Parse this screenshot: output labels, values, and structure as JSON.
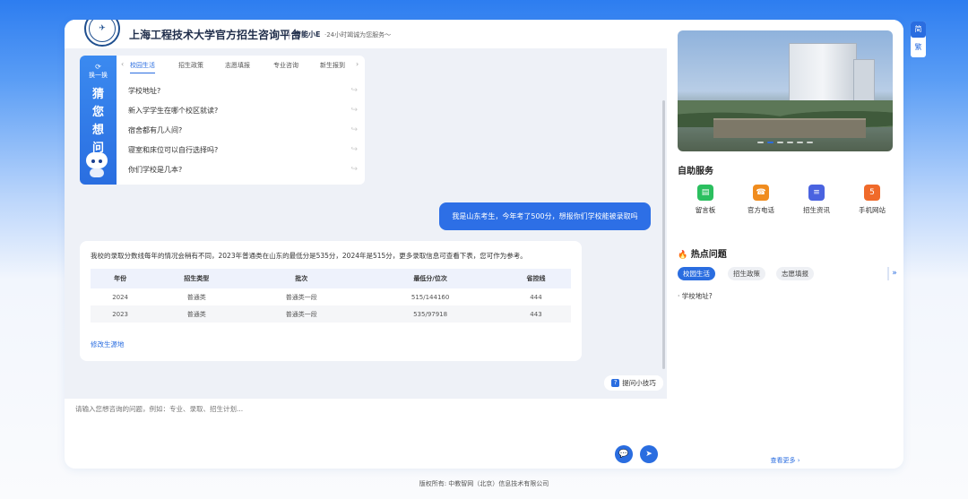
{
  "header": {
    "site_title": "上海工程技术大学官方招生咨询平台",
    "brand": "智能小E",
    "slogan": "·24小时竭诚为您服务～"
  },
  "qa_panel": {
    "refresh_label": "换一换",
    "side_chars": [
      "猜",
      "您",
      "想",
      "问"
    ],
    "tabs": [
      "校园生活",
      "招生政策",
      "志愿填报",
      "专业咨询",
      "新生报到"
    ],
    "active_tab": "校园生活",
    "questions": [
      "学校地址?",
      "新入学学生在哪个校区就读?",
      "宿舍都有几人间?",
      "寝室和床位可以自行选择吗?",
      "你们学校是几本?"
    ]
  },
  "chat": {
    "user_message": "我是山东考生，今年考了500分，想报你们学校能被录取吗",
    "bot_message": "我校的录取分数线每年的情况会稍有不同，2023年普通类在山东的最低分是535分，2024年是515分，更多录取信息可查看下表，您可作为参考。",
    "table_headers": [
      "年份",
      "招生类型",
      "批次",
      "最低分/位次",
      "省控线"
    ],
    "table_rows": [
      [
        "2024",
        "普通类",
        "普通类一段",
        "515/144160",
        "444"
      ],
      [
        "2023",
        "普通类",
        "普通类一段",
        "535/97918",
        "443"
      ]
    ],
    "modify_link": "修改生源地"
  },
  "tips_label": "提问小技巧",
  "input": {
    "placeholder": "请输入您想咨询的问题，例如：专业、录取、招生计划..."
  },
  "self_service": {
    "title": "自助服务",
    "items": [
      {
        "label": "留言板",
        "icon": "message-board-icon",
        "color": "#2bbf5f"
      },
      {
        "label": "官方电话",
        "icon": "phone-icon",
        "color": "#f08c1e"
      },
      {
        "label": "招生资讯",
        "icon": "news-icon",
        "color": "#4a63e0"
      },
      {
        "label": "手机网站",
        "icon": "html5-icon",
        "color": "#f06a2a"
      }
    ]
  },
  "hot": {
    "title": "热点问题",
    "tabs": [
      "校园生活",
      "招生政策",
      "志愿填报"
    ],
    "active_tab": "校园生活",
    "items": [
      "学校地址?"
    ],
    "see_more": "查看更多"
  },
  "language": {
    "simplified": "简",
    "traditional": "繁"
  },
  "footer": "版权所有: 中教智网（北京）信息技术有限公司",
  "colors": {
    "accent": "#2a6de0",
    "background_top": "#2d7df0"
  }
}
